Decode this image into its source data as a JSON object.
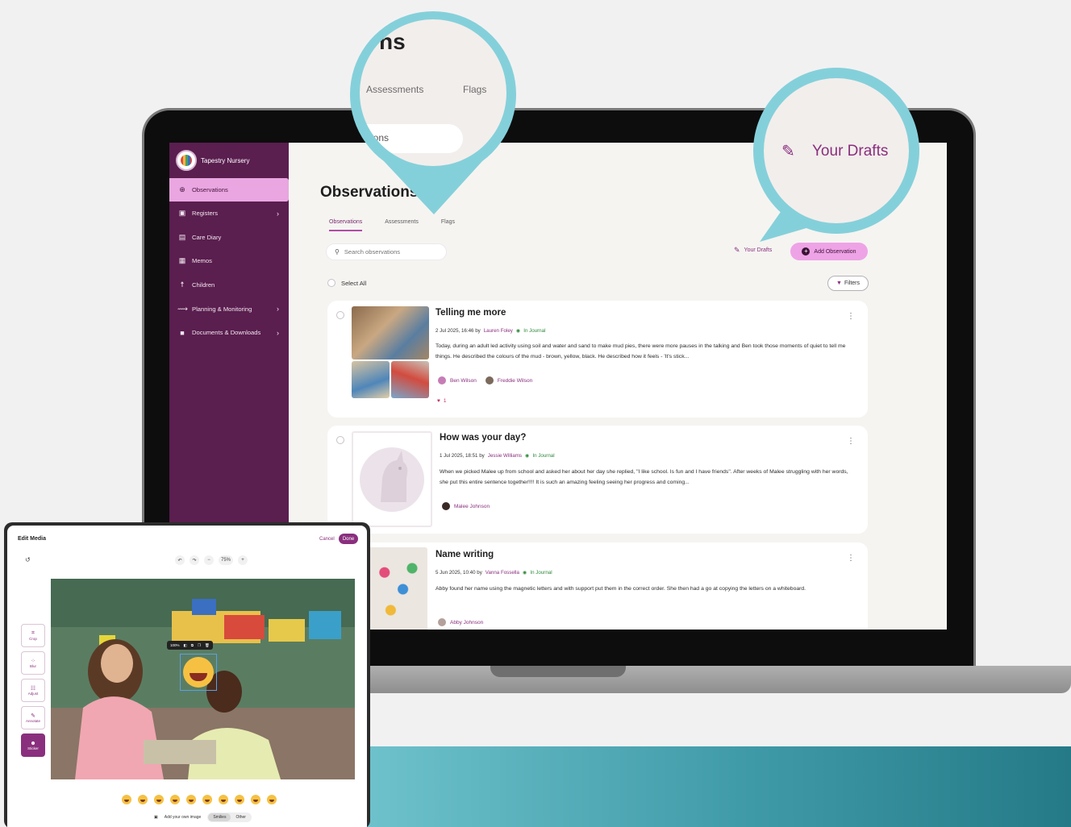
{
  "colors": {
    "sidebar": "#5a1e4f",
    "accent": "#eea3e6",
    "callout": "#84d0da",
    "brand": "#8a2f7e"
  },
  "sidebar": {
    "brand": "Tapestry Nursery",
    "items": [
      {
        "label": "Observations",
        "icon": "observations-icon"
      },
      {
        "label": "Registers",
        "icon": "calendar-icon"
      },
      {
        "label": "Care Diary",
        "icon": "diary-icon"
      },
      {
        "label": "Memos",
        "icon": "memo-icon"
      },
      {
        "label": "Children",
        "icon": "child-icon"
      },
      {
        "label": "Planning & Monitoring",
        "icon": "planning-icon"
      },
      {
        "label": "Documents & Downloads",
        "icon": "folder-icon"
      }
    ]
  },
  "main": {
    "title": "Observations",
    "tabs": [
      "Observations",
      "Assessments",
      "Flags"
    ],
    "search_placeholder": "Search observations",
    "drafts_label": "Your Drafts",
    "add_label": "Add Observation",
    "select_all": "Select All",
    "filters": "Filters",
    "cards": [
      {
        "title": "Telling me more",
        "date": "2 Jul 2025, 16:46 by",
        "author": "Lauren Foley",
        "journal": "In Journal",
        "body": "Today, during an adult led activity using soil and water and sand to make mud pies, there were more pauses in the talking and Ben took those moments of quiet to tell me things. He described the colours of the mud - brown, yellow, black. He described how it feels - 'It's stick...",
        "tags": [
          "Ben Wilson",
          "Freddie Wilson"
        ],
        "likes": "1"
      },
      {
        "title": "How was your day?",
        "date": "1 Jul 2025, 18:51 by",
        "author": "Jessie Williams",
        "journal": "In Journal",
        "body": "When we picked Malee up from school and asked her about her day she replied, \"I like school. Is fun and I have friends\". After weeks of Malee struggling with her words, she put this entire sentence together!!!! It is such an amazing feeling seeing her progress and coming...",
        "tags": [
          "Malee Johnson"
        ]
      },
      {
        "title": "Name writing",
        "date": "5 Jun 2025, 10:40 by",
        "author": "Vanna Fossella",
        "journal": "In Journal",
        "body": "Abby found her name using the magnetic letters and with support put them in the correct order. She then had a go at copying the letters on a whiteboard.",
        "tags": [
          "Abby Johnson"
        ]
      }
    ]
  },
  "callout_tabs": {
    "title_fragment": "ns",
    "tab1": "Assessments",
    "tab2": "Flags",
    "field_fragment": "ions"
  },
  "callout_drafts": {
    "label": "Your Drafts"
  },
  "editor": {
    "title": "Edit Media",
    "cancel": "Cancel",
    "done": "Done",
    "zoom": "75%",
    "sticker_zoom": "100%",
    "tools": [
      "Crop",
      "Blur",
      "Adjust",
      "Annotate",
      "Sticker"
    ],
    "add_image": "Add your own image",
    "seg_smilies": "Smilies",
    "seg_other": "Other"
  }
}
